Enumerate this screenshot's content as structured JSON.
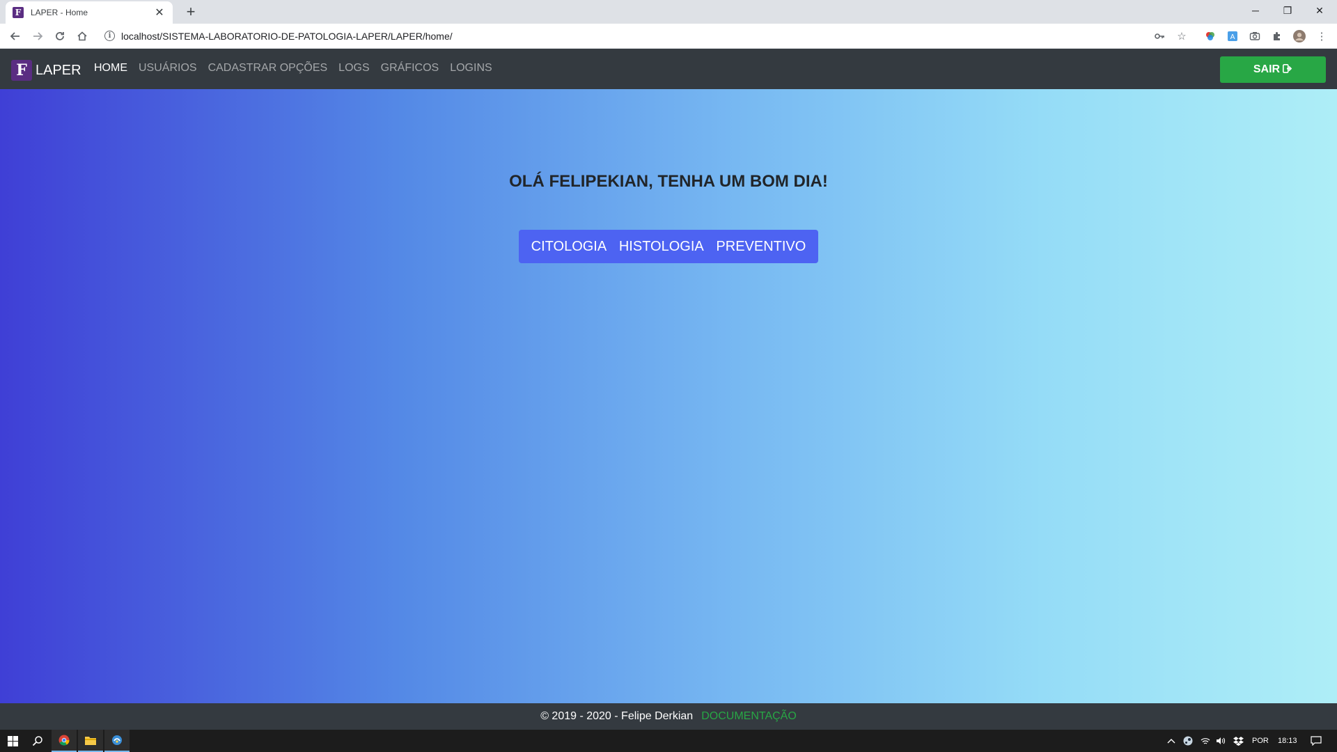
{
  "browser": {
    "tab_title": "LAPER - Home",
    "favicon_letter": "F",
    "close_glyph": "✕",
    "new_tab_glyph": "+",
    "url": "localhost/SISTEMA-LABORATORIO-DE-PATOLOGIA-LAPER/LAPER/home/",
    "window_controls": [
      "─",
      "❐",
      "✕"
    ]
  },
  "navbar": {
    "brand_logo_letter": "F",
    "brand": "LAPER",
    "links": [
      {
        "label": "HOME",
        "active": true
      },
      {
        "label": "USUÁRIOS"
      },
      {
        "label": "CADASTRAR OPÇÕES"
      },
      {
        "label": "LOGS"
      },
      {
        "label": "GRÁFICOS"
      },
      {
        "label": "LOGINS"
      }
    ],
    "logout_label": "SAIR",
    "logout_icon": "sign-out-icon"
  },
  "main": {
    "greeting": "OLÁ FELIPEKIAN, TENHA UM BOM DIA!",
    "buttons": [
      {
        "label": "CITOLOGIA"
      },
      {
        "label": "HISTOLOGIA"
      },
      {
        "label": "PREVENTIVO"
      }
    ]
  },
  "footer": {
    "copyright": "© 2019 - 2020 - Felipe Derkian",
    "doc_link": "DOCUMENTAÇÃO"
  },
  "taskbar": {
    "language": "POR",
    "time": "18:13"
  },
  "colors": {
    "navbar_bg": "#343a40",
    "success": "#28a745",
    "button_group": "#4d63f2",
    "gradient_start": "#3f3fd6",
    "gradient_end": "#aeeef7"
  }
}
